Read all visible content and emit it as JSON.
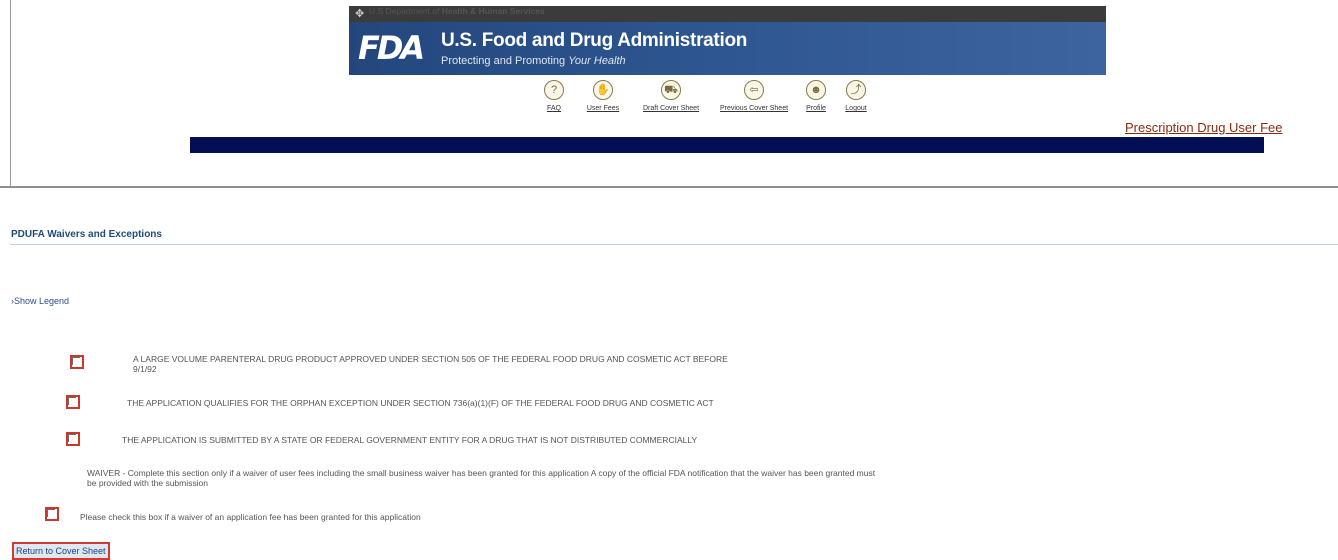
{
  "header": {
    "department_prefix": "U.S Department of ",
    "department_bold": "Health & Human Services",
    "logo_text": "FDA",
    "agency_title": "U.S. Food and Drug Administration",
    "tagline_prefix": "Protecting and Promoting ",
    "tagline_emphasis": "Your Health"
  },
  "nav": {
    "items": [
      {
        "label": "FAQ",
        "icon": "question-icon",
        "glyph": "?"
      },
      {
        "label": "User Fees",
        "icon": "hand-coin-icon",
        "glyph": "✋"
      },
      {
        "label": "Draft Cover Sheet",
        "icon": "cart-icon",
        "glyph": "⛟"
      },
      {
        "label": "Previous Cover Sheet",
        "icon": "back-arrow-icon",
        "glyph": "⇦"
      },
      {
        "label": "Profile",
        "icon": "users-icon",
        "glyph": "☻"
      },
      {
        "label": "Logout",
        "icon": "logout-icon",
        "glyph": "⤴"
      }
    ],
    "program_link": "Prescription Drug User Fee"
  },
  "page": {
    "section_title": "PDUFA Waivers and Exceptions",
    "legend_toggle": "Show Legend",
    "options": [
      {
        "line1": "A LARGE VOLUME PARENTERAL DRUG PRODUCT APPROVED UNDER SECTION 505 OF THE FEDERAL FOOD DRUG AND COSMETIC ACT BEFORE",
        "line2": "9/1/92"
      },
      {
        "line1": "THE APPLICATION QUALIFIES FOR THE ORPHAN EXCEPTION UNDER SECTION 736(a)(1)(F) OF THE FEDERAL FOOD DRUG AND COSMETIC ACT"
      },
      {
        "line1": "THE APPLICATION IS SUBMITTED BY A STATE OR FEDERAL GOVERNMENT ENTITY FOR A DRUG THAT IS NOT DISTRIBUTED COMMERCIALLY"
      }
    ],
    "waiver_line1": "WAIVER - Complete this section only if a waiver of user fees including the small business waiver has been granted for this application A copy of the official FDA notification that the waiver has been granted must",
    "waiver_line2": "be provided with the submission",
    "waiver_checkbox_label": "Please check this box if a waiver of an application fee has been granted for this application",
    "return_button": "Return to Cover Sheet"
  },
  "colors": {
    "banner_blue": "#2d558f",
    "navy_bar": "#030e55",
    "checkbox_border": "#c8392c",
    "link_brown": "#8b2a0f"
  }
}
